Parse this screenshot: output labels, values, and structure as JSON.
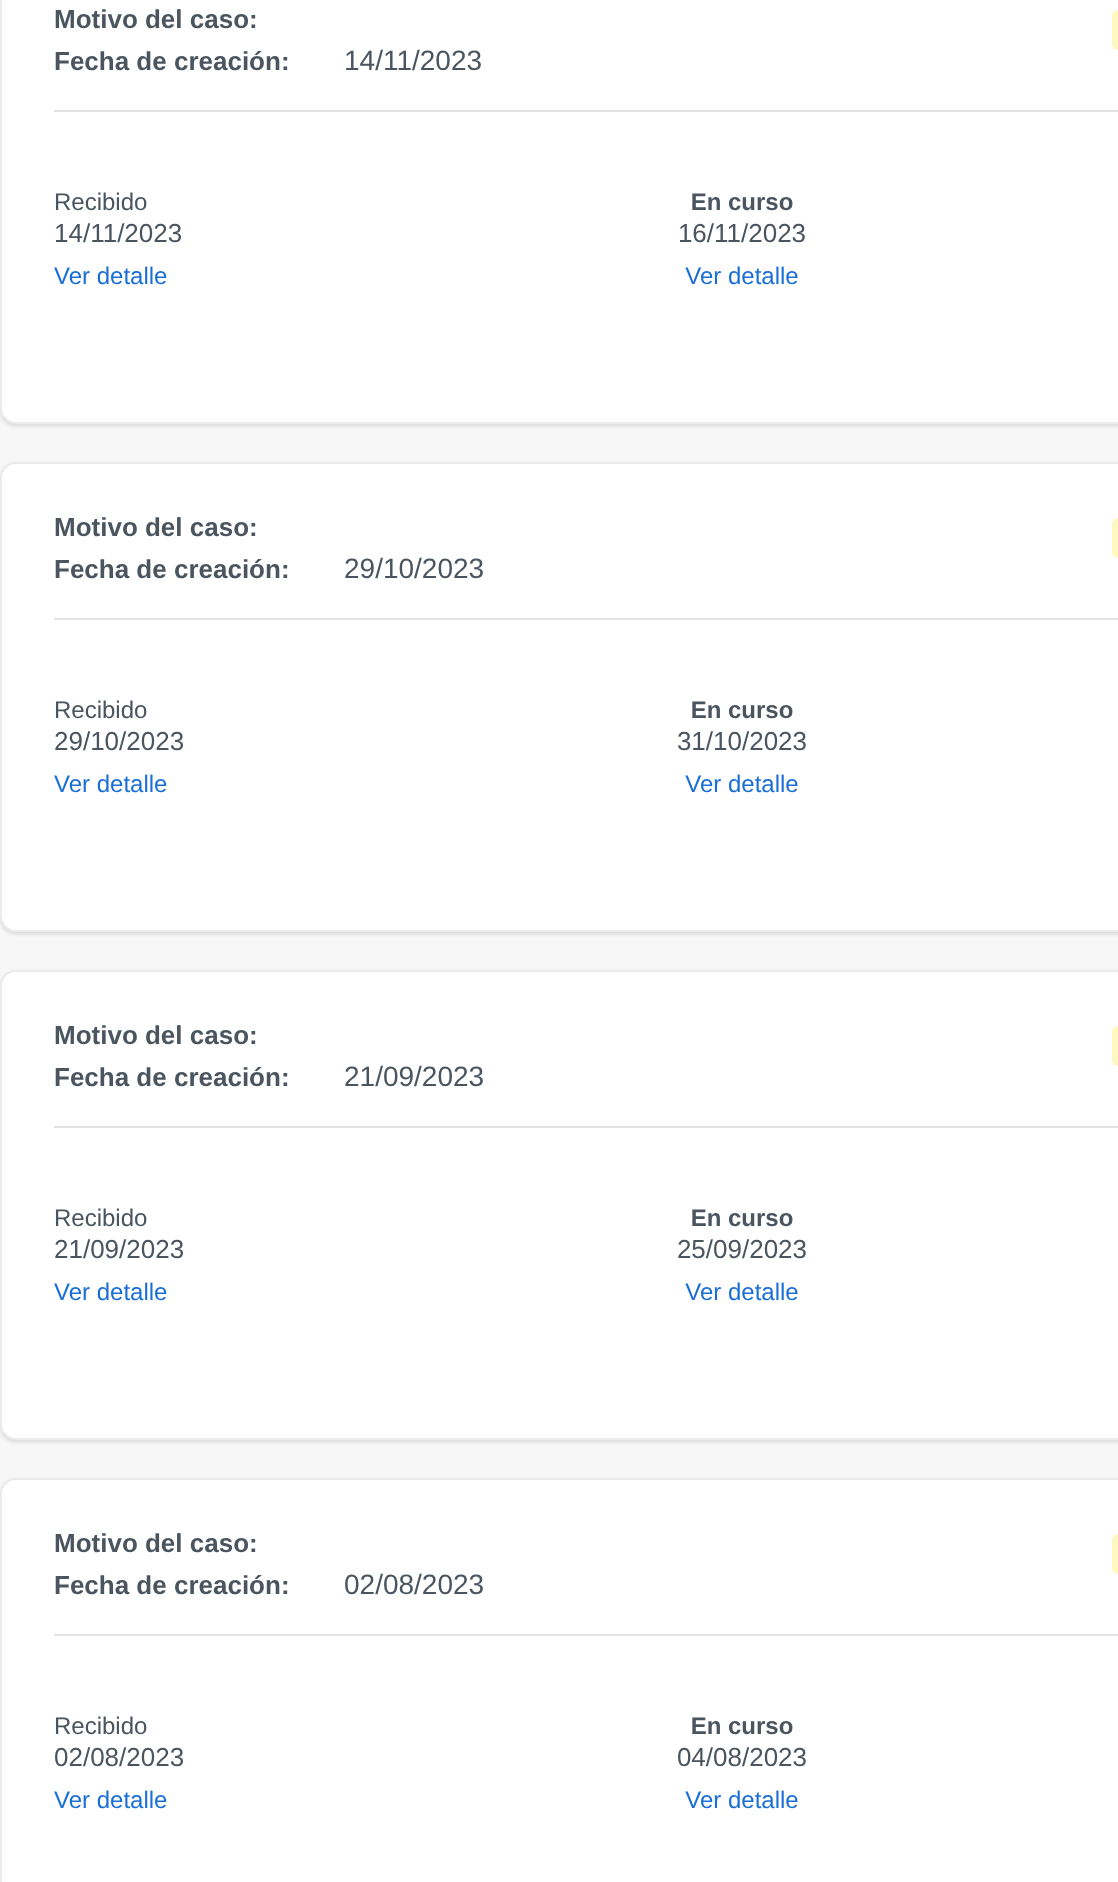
{
  "cases": [
    {
      "reason_label": "Motivo del caso:",
      "date_label": "Fecha de creación:",
      "date": "14/11/2023",
      "steps": [
        {
          "label": "Recibido",
          "date": "14/11/2023",
          "link": "Ver detalle",
          "current": false
        },
        {
          "label": "En curso",
          "date": "16/11/2023",
          "link": "Ver detalle",
          "current": true
        }
      ]
    },
    {
      "reason_label": "Motivo del caso:",
      "date_label": "Fecha de creación:",
      "date": "29/10/2023",
      "steps": [
        {
          "label": "Recibido",
          "date": "29/10/2023",
          "link": "Ver detalle",
          "current": false
        },
        {
          "label": "En curso",
          "date": "31/10/2023",
          "link": "Ver detalle",
          "current": true
        }
      ]
    },
    {
      "reason_label": "Motivo del caso:",
      "date_label": "Fecha de creación:",
      "date": "21/09/2023",
      "steps": [
        {
          "label": "Recibido",
          "date": "21/09/2023",
          "link": "Ver detalle",
          "current": false
        },
        {
          "label": "En curso",
          "date": "25/09/2023",
          "link": "Ver detalle",
          "current": true
        }
      ]
    },
    {
      "reason_label": "Motivo del caso:",
      "date_label": "Fecha de creación:",
      "date": "02/08/2023",
      "steps": [
        {
          "label": "Recibido",
          "date": "02/08/2023",
          "link": "Ver detalle",
          "current": false
        },
        {
          "label": "En curso",
          "date": "04/08/2023",
          "link": "Ver detalle",
          "current": true
        }
      ]
    }
  ]
}
